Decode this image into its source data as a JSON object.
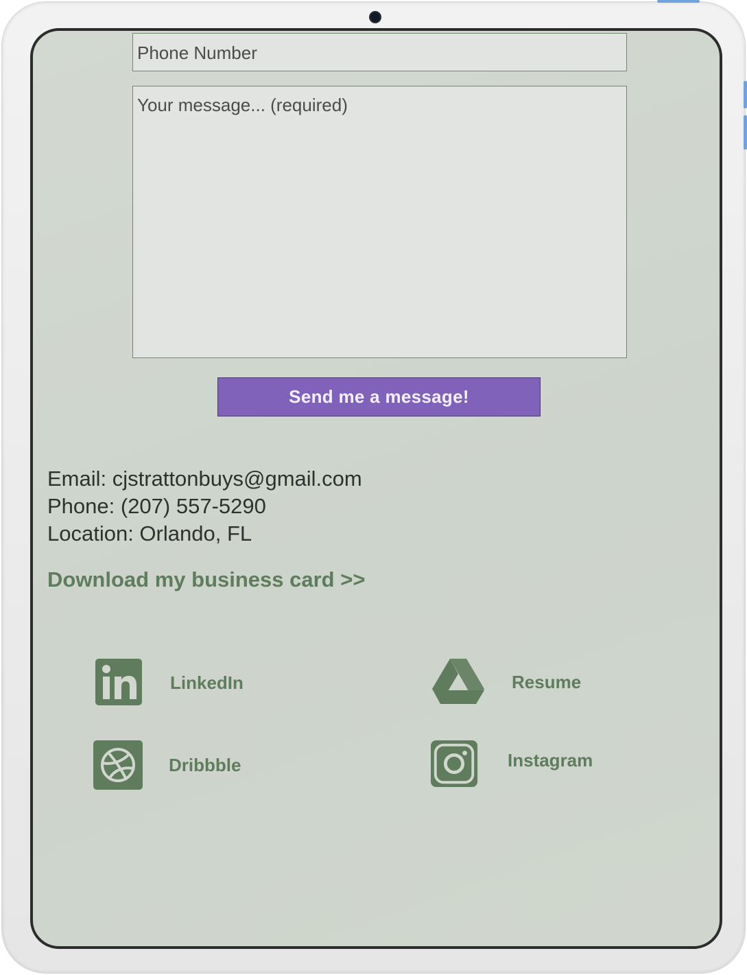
{
  "form": {
    "phone_placeholder": "Phone Number",
    "message_placeholder": "Your message... (required)",
    "send_label": "Send me a message!"
  },
  "contact": {
    "email": "Email: cjstrattonbuys@gmail.com",
    "phone": "Phone: (207) 557-5290",
    "location": "Location: Orlando, FL"
  },
  "download_link": "Download my business card >>",
  "social": {
    "linkedin": {
      "label": "LinkedIn",
      "icon": "linkedin-icon"
    },
    "resume": {
      "label": "Resume",
      "icon": "google-drive-icon"
    },
    "dribbble": {
      "label": "Dribbble",
      "icon": "dribbble-icon"
    },
    "instagram": {
      "label": "Instagram",
      "icon": "instagram-icon"
    }
  },
  "colors": {
    "background": "#cfd6cd",
    "accent_green": "#5e7d5c",
    "button_purple": "#8162ba",
    "field_bg": "#e1e4e1"
  }
}
